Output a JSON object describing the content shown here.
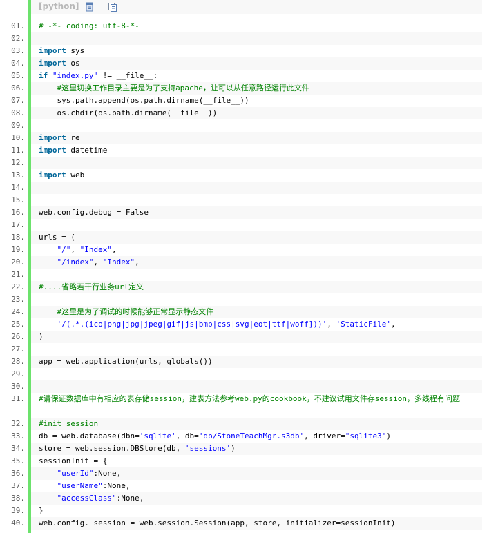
{
  "toolbar": {
    "language": "[python]",
    "view_icon": "view-source-icon",
    "copy_icon": "copy-icon"
  },
  "lines": [
    {
      "num": "01.",
      "tokens": [
        {
          "t": "# -*- coding: utf-8-*-",
          "c": "cm"
        }
      ]
    },
    {
      "num": "02.",
      "tokens": []
    },
    {
      "num": "03.",
      "tokens": [
        {
          "t": "import",
          "c": "kw"
        },
        {
          "t": " sys",
          "c": ""
        }
      ]
    },
    {
      "num": "04.",
      "tokens": [
        {
          "t": "import",
          "c": "kw"
        },
        {
          "t": " os",
          "c": ""
        }
      ]
    },
    {
      "num": "05.",
      "tokens": [
        {
          "t": "if",
          "c": "kw"
        },
        {
          "t": " ",
          "c": ""
        },
        {
          "t": "\"index.py\"",
          "c": "str"
        },
        {
          "t": " != __file__:",
          "c": ""
        }
      ]
    },
    {
      "num": "06.",
      "tokens": [
        {
          "t": "    ",
          "c": ""
        },
        {
          "t": "#这里切换工作目录主要是为了支持apache，让可以从任意路径运行此文件",
          "c": "cm"
        }
      ]
    },
    {
      "num": "07.",
      "tokens": [
        {
          "t": "    sys.path.append(os.path.dirname(__file__))",
          "c": ""
        }
      ]
    },
    {
      "num": "08.",
      "tokens": [
        {
          "t": "    os.chdir(os.path.dirname(__file__))",
          "c": ""
        }
      ]
    },
    {
      "num": "09.",
      "tokens": []
    },
    {
      "num": "10.",
      "tokens": [
        {
          "t": "import",
          "c": "kw"
        },
        {
          "t": " re",
          "c": ""
        }
      ]
    },
    {
      "num": "11.",
      "tokens": [
        {
          "t": "import",
          "c": "kw"
        },
        {
          "t": " datetime",
          "c": ""
        }
      ]
    },
    {
      "num": "12.",
      "tokens": []
    },
    {
      "num": "13.",
      "tokens": [
        {
          "t": "import",
          "c": "kw"
        },
        {
          "t": " web",
          "c": ""
        }
      ]
    },
    {
      "num": "14.",
      "tokens": []
    },
    {
      "num": "15.",
      "tokens": []
    },
    {
      "num": "16.",
      "tokens": [
        {
          "t": "web.config.debug = False",
          "c": ""
        }
      ]
    },
    {
      "num": "17.",
      "tokens": []
    },
    {
      "num": "18.",
      "tokens": [
        {
          "t": "urls = (",
          "c": ""
        }
      ]
    },
    {
      "num": "19.",
      "tokens": [
        {
          "t": "    ",
          "c": ""
        },
        {
          "t": "\"/\"",
          "c": "str"
        },
        {
          "t": ", ",
          "c": ""
        },
        {
          "t": "\"Index\"",
          "c": "str"
        },
        {
          "t": ",",
          "c": ""
        }
      ]
    },
    {
      "num": "20.",
      "tokens": [
        {
          "t": "    ",
          "c": ""
        },
        {
          "t": "\"/index\"",
          "c": "str"
        },
        {
          "t": ", ",
          "c": ""
        },
        {
          "t": "\"Index\"",
          "c": "str"
        },
        {
          "t": ",",
          "c": ""
        }
      ]
    },
    {
      "num": "21.",
      "tokens": []
    },
    {
      "num": "22.",
      "tokens": [
        {
          "t": "#....省略若干行业务url定义",
          "c": "cm"
        }
      ]
    },
    {
      "num": "23.",
      "tokens": []
    },
    {
      "num": "24.",
      "tokens": [
        {
          "t": "    ",
          "c": ""
        },
        {
          "t": "#这里是为了调试的时候能够正常显示静态文件",
          "c": "cm"
        }
      ]
    },
    {
      "num": "25.",
      "tokens": [
        {
          "t": "    ",
          "c": ""
        },
        {
          "t": "'/(.*.(ico|png|jpg|jpeg|gif|js|bmp|css|svg|eot|ttf|woff]))'",
          "c": "str"
        },
        {
          "t": ", ",
          "c": ""
        },
        {
          "t": "'StaticFile'",
          "c": "str"
        },
        {
          "t": ",",
          "c": ""
        }
      ]
    },
    {
      "num": "26.",
      "tokens": [
        {
          "t": ")",
          "c": ""
        }
      ]
    },
    {
      "num": "27.",
      "tokens": []
    },
    {
      "num": "28.",
      "tokens": [
        {
          "t": "app = web.application(urls, globals())",
          "c": ""
        }
      ]
    },
    {
      "num": "29.",
      "tokens": []
    },
    {
      "num": "30.",
      "tokens": []
    },
    {
      "num": "31.",
      "tall": true,
      "tokens": [
        {
          "t": "#请保证数据库中有相应的表存储session，建表方法参考web.py的cookbook，不建议试用文件存session，多线程有问题",
          "c": "cm"
        }
      ]
    },
    {
      "num": "32.",
      "tokens": [
        {
          "t": "#init session",
          "c": "cm"
        }
      ]
    },
    {
      "num": "33.",
      "tokens": [
        {
          "t": "db = web.database(dbn=",
          "c": ""
        },
        {
          "t": "'sqlite'",
          "c": "str"
        },
        {
          "t": ", db=",
          "c": ""
        },
        {
          "t": "'db/StoneTeachMgr.s3db'",
          "c": "str"
        },
        {
          "t": ", driver=",
          "c": ""
        },
        {
          "t": "\"sqlite3\"",
          "c": "str"
        },
        {
          "t": ")",
          "c": ""
        }
      ]
    },
    {
      "num": "34.",
      "tokens": [
        {
          "t": "store = web.session.DBStore(db, ",
          "c": ""
        },
        {
          "t": "'sessions'",
          "c": "str"
        },
        {
          "t": ")",
          "c": ""
        }
      ]
    },
    {
      "num": "35.",
      "tokens": [
        {
          "t": "sessionInit = {",
          "c": ""
        }
      ]
    },
    {
      "num": "36.",
      "tokens": [
        {
          "t": "    ",
          "c": ""
        },
        {
          "t": "\"userId\"",
          "c": "str"
        },
        {
          "t": ":None,",
          "c": ""
        }
      ]
    },
    {
      "num": "37.",
      "tokens": [
        {
          "t": "    ",
          "c": ""
        },
        {
          "t": "\"userName\"",
          "c": "str"
        },
        {
          "t": ":None,",
          "c": ""
        }
      ]
    },
    {
      "num": "38.",
      "tokens": [
        {
          "t": "    ",
          "c": ""
        },
        {
          "t": "\"accessClass\"",
          "c": "str"
        },
        {
          "t": ":None,",
          "c": ""
        }
      ]
    },
    {
      "num": "39.",
      "tokens": [
        {
          "t": "}",
          "c": ""
        }
      ]
    },
    {
      "num": "40.",
      "tokens": [
        {
          "t": "web.config._session = web.session.Session(app, store, initializer=sessionInit)",
          "c": ""
        }
      ]
    }
  ]
}
